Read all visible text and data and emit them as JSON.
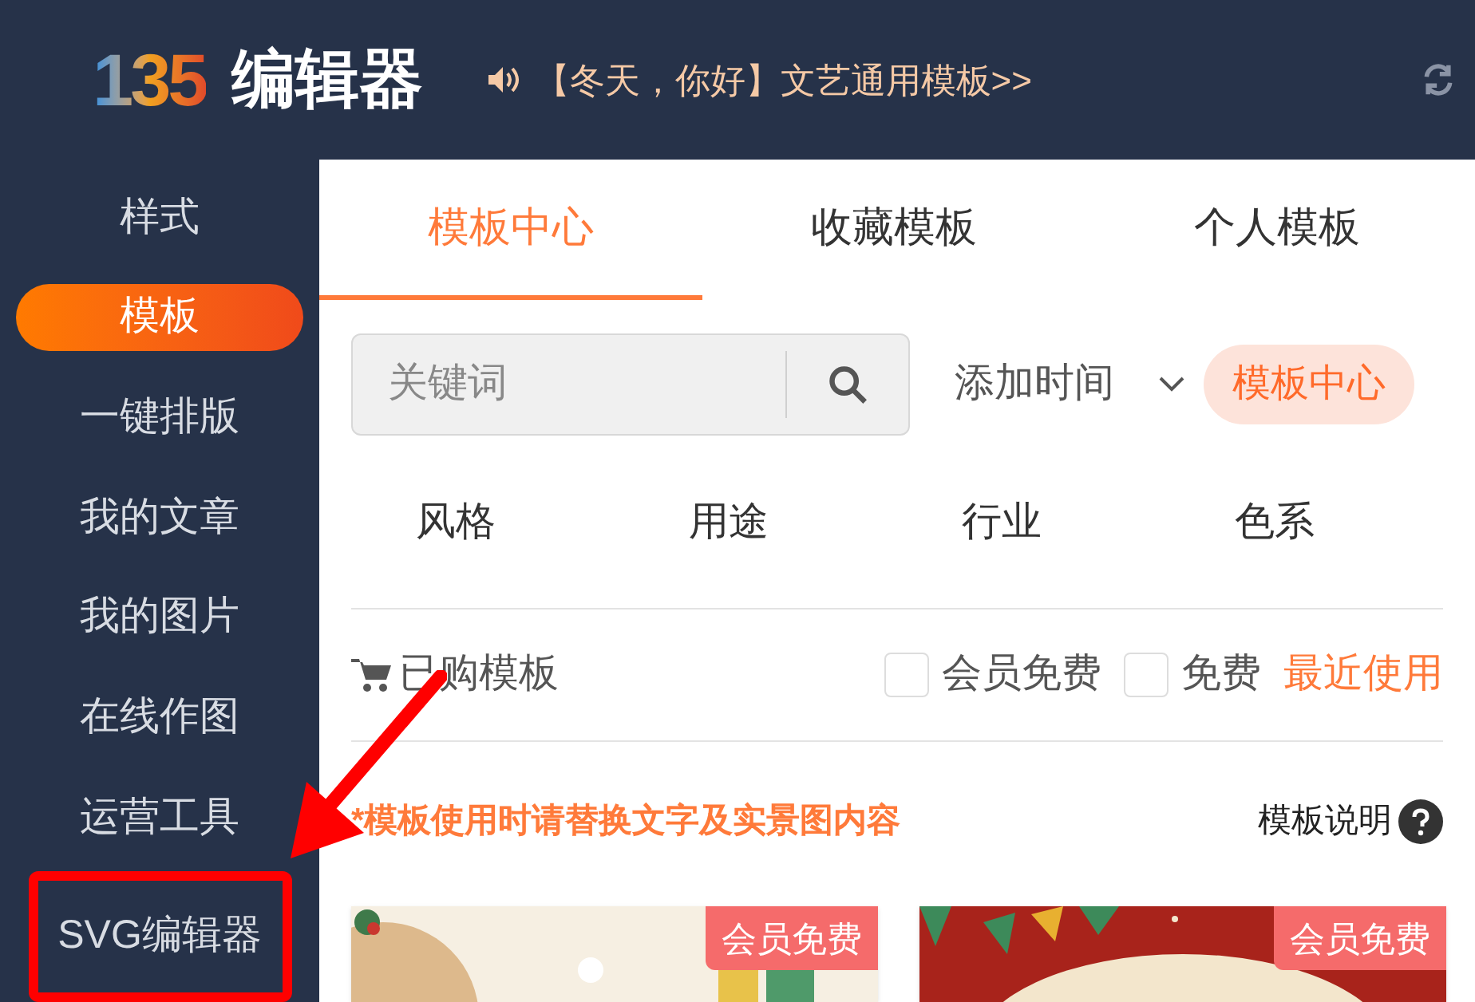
{
  "header": {
    "logo_mark": "135",
    "logo_text": "编辑器",
    "notice": "【冬天，你好】文艺通用模板>>"
  },
  "sidebar": {
    "items": [
      {
        "label": "样式",
        "selected": false,
        "highlighted": false
      },
      {
        "label": "模板",
        "selected": true,
        "highlighted": false
      },
      {
        "label": "一键排版",
        "selected": false,
        "highlighted": false
      },
      {
        "label": "我的文章",
        "selected": false,
        "highlighted": false
      },
      {
        "label": "我的图片",
        "selected": false,
        "highlighted": false
      },
      {
        "label": "在线作图",
        "selected": false,
        "highlighted": false
      },
      {
        "label": "运营工具",
        "selected": false,
        "highlighted": false
      },
      {
        "label": "SVG编辑器",
        "selected": false,
        "highlighted": true
      }
    ]
  },
  "tabs": [
    {
      "label": "模板中心",
      "selected": true
    },
    {
      "label": "收藏模板",
      "selected": false
    },
    {
      "label": "个人模板",
      "selected": false
    }
  ],
  "search": {
    "placeholder": "关键词"
  },
  "sort": {
    "value": "添加时间"
  },
  "source_chip": "模板中心",
  "filters": [
    "风格",
    "用途",
    "行业",
    "色系"
  ],
  "purchased": "已购模板",
  "checks": [
    {
      "label": "会员免费",
      "checked": false
    },
    {
      "label": "免费",
      "checked": false
    }
  ],
  "recent": "最近使用",
  "note": "*模板使用时请替换文字及实景图内容",
  "help": "模板说明",
  "cards": [
    {
      "badge": "会员免费",
      "kind": "picture"
    },
    {
      "badge": "会员免费",
      "kind": "picture"
    }
  ]
}
